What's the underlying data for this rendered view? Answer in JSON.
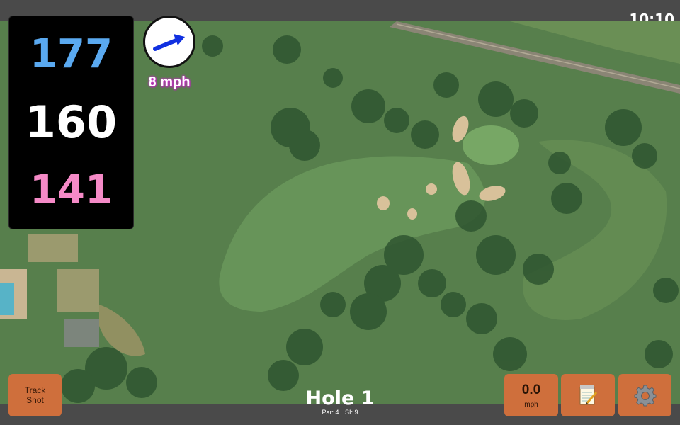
{
  "status": {
    "time": "10:10"
  },
  "distances": {
    "back": "177",
    "middle": "160",
    "front": "141"
  },
  "wind": {
    "speed_label": "8 mph",
    "icon": "wind-arrow-icon"
  },
  "hole": {
    "title": "Hole 1",
    "par_label": "Par: 4",
    "si_label": "SI: 9"
  },
  "buttons": {
    "track_shot_line1": "Track",
    "track_shot_line2": "Shot",
    "speed_value": "0.0",
    "speed_unit": "mph",
    "notes_icon": "notepad-icon",
    "settings_icon": "gear-icon"
  },
  "colors": {
    "back_distance": "#5aa9f0",
    "middle_distance": "#ffffff",
    "front_distance": "#f58ac7",
    "button": "#cf6f3c",
    "wind_arrow": "#1030e0"
  }
}
